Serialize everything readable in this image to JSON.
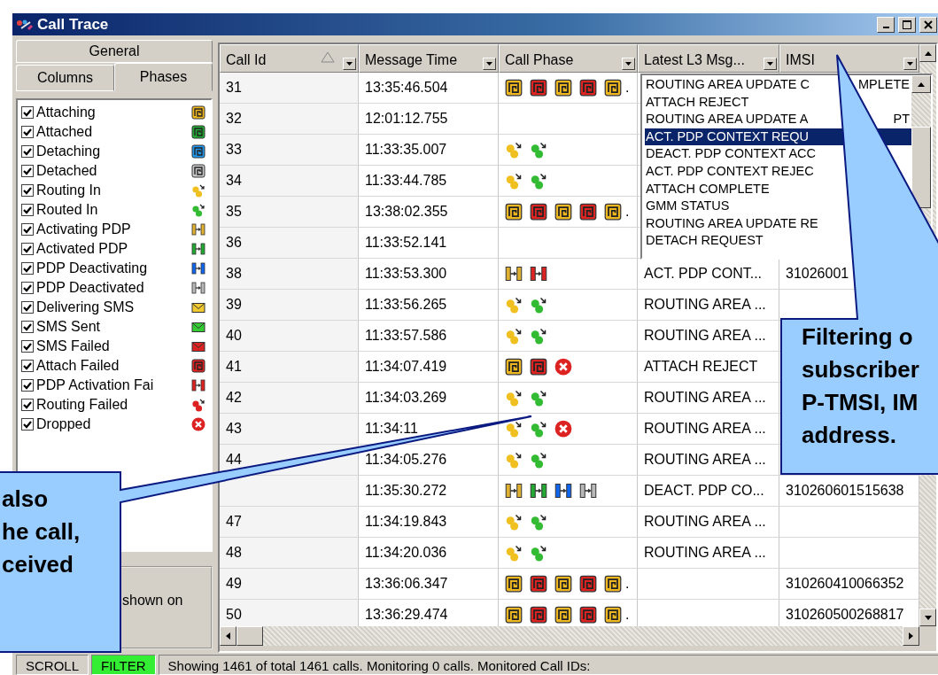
{
  "window": {
    "title": "Call Trace"
  },
  "tab_rows": [
    [
      {
        "label": "General",
        "selected": false
      }
    ],
    [
      {
        "label": "Columns",
        "selected": false
      },
      {
        "label": "Phases",
        "selected": true
      }
    ]
  ],
  "phases": [
    {
      "label": "Attaching",
      "checked": true,
      "kind": "attach",
      "color": "#f0b820"
    },
    {
      "label": "Attached",
      "checked": true,
      "kind": "attach",
      "color": "#22aa33"
    },
    {
      "label": "Detaching",
      "checked": true,
      "kind": "attach",
      "color": "#2299ee"
    },
    {
      "label": "Detached",
      "checked": true,
      "kind": "attach",
      "color": "#c8c8c8"
    },
    {
      "label": "Routing In",
      "checked": true,
      "kind": "routing",
      "color": "#f0c020"
    },
    {
      "label": "Routed In",
      "checked": true,
      "kind": "routing",
      "color": "#33bb33"
    },
    {
      "label": "Activating PDP",
      "checked": true,
      "kind": "pdp",
      "color": "#e0b030"
    },
    {
      "label": "Activated PDP",
      "checked": true,
      "kind": "pdp",
      "color": "#22aa33"
    },
    {
      "label": "PDP Deactivating",
      "checked": true,
      "kind": "pdp",
      "color": "#1166ee"
    },
    {
      "label": "PDP Deactivated",
      "checked": true,
      "kind": "pdp",
      "color": "#b8b8b8"
    },
    {
      "label": "Delivering SMS",
      "checked": true,
      "kind": "sms",
      "color": "#f0c830"
    },
    {
      "label": "SMS Sent",
      "checked": true,
      "kind": "sms",
      "color": "#33cc33"
    },
    {
      "label": "SMS Failed",
      "checked": true,
      "kind": "sms",
      "color": "#dd2222"
    },
    {
      "label": "Attach Failed",
      "checked": true,
      "kind": "attach",
      "color": "#dd2222"
    },
    {
      "label": "PDP Activation Fai",
      "checked": true,
      "kind": "pdp",
      "color": "#dd2222"
    },
    {
      "label": "Routing Failed",
      "checked": true,
      "kind": "routing",
      "color": "#dd2222"
    },
    {
      "label": "Dropped",
      "checked": true,
      "kind": "dropped",
      "color": "#dd2222"
    }
  ],
  "panel_note": "shown on",
  "table": {
    "columns": [
      {
        "label": "Call Id",
        "sorted": true
      },
      {
        "label": "Message Time",
        "sorted": false
      },
      {
        "label": "Call Phase",
        "sorted": false
      },
      {
        "label": "Latest L3 Msg...",
        "sorted": false
      },
      {
        "label": "IMSI",
        "sorted": false
      }
    ],
    "rows": [
      {
        "call_id": "31",
        "time": "13:35:46.504",
        "phases": [
          {
            "kind": "attach",
            "color": "#f0b820"
          },
          {
            "kind": "attach",
            "color": "#dd2222"
          },
          {
            "kind": "attach",
            "color": "#f0b820"
          },
          {
            "kind": "attach",
            "color": "#dd2222"
          },
          {
            "kind": "attach",
            "color": "#f0b820"
          }
        ],
        "more": "."
      },
      {
        "call_id": "32",
        "time": "12:01:12.755",
        "phases": []
      },
      {
        "call_id": "33",
        "time": "11:33:35.007",
        "phases": [
          {
            "kind": "routing",
            "color": "#f0c020"
          },
          {
            "kind": "routing",
            "color": "#33bb33"
          }
        ]
      },
      {
        "call_id": "34",
        "time": "11:33:44.785",
        "phases": [
          {
            "kind": "routing",
            "color": "#f0c020"
          },
          {
            "kind": "routing",
            "color": "#33bb33"
          }
        ]
      },
      {
        "call_id": "35",
        "time": "13:38:02.355",
        "phases": [
          {
            "kind": "attach",
            "color": "#f0b820"
          },
          {
            "kind": "attach",
            "color": "#dd2222"
          },
          {
            "kind": "attach",
            "color": "#f0b820"
          },
          {
            "kind": "attach",
            "color": "#dd2222"
          },
          {
            "kind": "attach",
            "color": "#f0b820"
          }
        ],
        "more": "."
      },
      {
        "call_id": "36",
        "time": "11:33:52.141",
        "phases": []
      },
      {
        "call_id": "38",
        "time": "11:33:53.300",
        "phases": [
          {
            "kind": "pdp",
            "color": "#e0b030"
          },
          {
            "kind": "pdp",
            "color": "#dd2222"
          }
        ],
        "l3": "ACT. PDP CONT...",
        "imsi": "31026001"
      },
      {
        "call_id": "39",
        "time": "11:33:56.265",
        "phases": [
          {
            "kind": "routing",
            "color": "#f0c020"
          },
          {
            "kind": "routing",
            "color": "#33bb33"
          }
        ],
        "l3": "ROUTING AREA ..."
      },
      {
        "call_id": "40",
        "time": "11:33:57.586",
        "phases": [
          {
            "kind": "routing",
            "color": "#f0c020"
          },
          {
            "kind": "routing",
            "color": "#33bb33"
          }
        ],
        "l3": "ROUTING AREA ..."
      },
      {
        "call_id": "41",
        "time": "11:34:07.419",
        "phases": [
          {
            "kind": "attach",
            "color": "#f0b820"
          },
          {
            "kind": "attach",
            "color": "#dd2222"
          },
          {
            "kind": "dropped",
            "color": "#dd2222"
          }
        ],
        "l3": "ATTACH REJECT"
      },
      {
        "call_id": "42",
        "time": "11:34:03.269",
        "phases": [
          {
            "kind": "routing",
            "color": "#f0c020"
          },
          {
            "kind": "routing",
            "color": "#33bb33"
          }
        ],
        "l3": "ROUTING AREA ..."
      },
      {
        "call_id": "43",
        "time": "11:34:11",
        "phases": [
          {
            "kind": "routing",
            "color": "#f0c020"
          },
          {
            "kind": "routing",
            "color": "#33bb33"
          },
          {
            "kind": "dropped",
            "color": "#dd2222"
          }
        ],
        "l3": "ROUTING AREA ..."
      },
      {
        "call_id": "44",
        "time": "11:34:05.276",
        "phases": [
          {
            "kind": "routing",
            "color": "#f0c020"
          },
          {
            "kind": "routing",
            "color": "#33bb33"
          }
        ],
        "l3": "ROUTING AREA ..."
      },
      {
        "time": "11:35:30.272",
        "phases": [
          {
            "kind": "pdp",
            "color": "#e0b030"
          },
          {
            "kind": "pdp",
            "color": "#22aa33"
          },
          {
            "kind": "pdp",
            "color": "#1166ee"
          },
          {
            "kind": "pdp",
            "color": "#b8b8b8"
          }
        ],
        "l3": "DEACT. PDP CO...",
        "imsi": "310260601515638"
      },
      {
        "call_id": "47",
        "time": "11:34:19.843",
        "phases": [
          {
            "kind": "routing",
            "color": "#f0c020"
          },
          {
            "kind": "routing",
            "color": "#33bb33"
          }
        ],
        "l3": "ROUTING AREA ..."
      },
      {
        "call_id": "48",
        "time": "11:34:20.036",
        "phases": [
          {
            "kind": "routing",
            "color": "#f0c020"
          },
          {
            "kind": "routing",
            "color": "#33bb33"
          }
        ],
        "l3": "ROUTING AREA ..."
      },
      {
        "call_id": "49",
        "time": "13:36:06.347",
        "phases": [
          {
            "kind": "attach",
            "color": "#f0b820"
          },
          {
            "kind": "attach",
            "color": "#dd2222"
          },
          {
            "kind": "attach",
            "color": "#f0b820"
          },
          {
            "kind": "attach",
            "color": "#dd2222"
          },
          {
            "kind": "attach",
            "color": "#f0b820"
          }
        ],
        "more": ".",
        "imsi": "310260410066352"
      },
      {
        "call_id": "50",
        "time": "13:36:29.474",
        "phases": [
          {
            "kind": "attach",
            "color": "#f0b820"
          },
          {
            "kind": "attach",
            "color": "#dd2222"
          },
          {
            "kind": "attach",
            "color": "#f0b820"
          },
          {
            "kind": "attach",
            "color": "#dd2222"
          },
          {
            "kind": "attach",
            "color": "#f0b820"
          }
        ],
        "more": ".",
        "imsi": "310260500268817"
      }
    ]
  },
  "dropdown": {
    "items": [
      {
        "text": "ROUTING AREA UPDATE C",
        "tail": "MPLETE",
        "selected": false
      },
      {
        "text": "ATTACH REJECT",
        "selected": false
      },
      {
        "text": "ROUTING AREA UPDATE A",
        "tail": "PT",
        "selected": false
      },
      {
        "text": "ACT. PDP CONTEXT REQU",
        "selected": true
      },
      {
        "text": "DEACT. PDP CONTEXT ACC",
        "selected": false
      },
      {
        "text": "ACT. PDP CONTEXT REJEC",
        "selected": false
      },
      {
        "text": "ATTACH COMPLETE",
        "selected": false
      },
      {
        "text": "GMM STATUS",
        "selected": false
      },
      {
        "text": "ROUTING AREA UPDATE RE",
        "selected": false
      },
      {
        "text": "DETACH REQUEST",
        "selected": false
      }
    ]
  },
  "status_bar": {
    "panels": [
      {
        "text": "SCROLL",
        "on": false
      },
      {
        "text": "FILTER",
        "on": true
      }
    ],
    "message": "Showing 1461 of total 1461 calls. Monitoring 0 calls. Monitored Call IDs:"
  },
  "callouts": [
    {
      "lines": [
        "Filtering o",
        "subscriber",
        "P-TMSI, IM",
        "address."
      ]
    },
    {
      "lines": [
        "also",
        "he call,",
        "ceived"
      ]
    }
  ]
}
